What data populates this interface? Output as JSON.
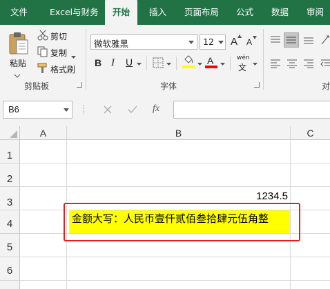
{
  "ribbon": {
    "tabs": [
      "文件",
      "Excel与财务",
      "开始",
      "插入",
      "页面布局",
      "公式",
      "数据",
      "审阅"
    ],
    "active_tab": "开始",
    "clipboard": {
      "paste": "粘贴",
      "cut": "剪切",
      "copy": "复制",
      "format_painter": "格式刷",
      "group": "剪贴板"
    },
    "font": {
      "name": "微软雅黑",
      "size": "12",
      "grow": "A",
      "shrink": "A",
      "bold": "B",
      "italic": "I",
      "underline": "U",
      "color_letter": "A",
      "phonetic_top": "wén",
      "phonetic_bottom": "文",
      "group": "字体",
      "highlight_color": "#ffff00",
      "font_color": "#ff0000"
    }
  },
  "formula_bar": {
    "name_box": "B6",
    "fx": "fx",
    "content": ""
  },
  "sheet": {
    "columns": [
      "A",
      "B",
      "C"
    ],
    "rows": [
      "1",
      "2",
      "3",
      "4",
      "5",
      "6"
    ],
    "cells": {
      "B3": "1234.5",
      "B4": "金额大写：人民币壹仟贰佰叁拾肆元伍角整"
    },
    "b4_fill": "#ffff00",
    "annotation_border": "#e02020"
  },
  "colors": {
    "accent": "#217346"
  }
}
